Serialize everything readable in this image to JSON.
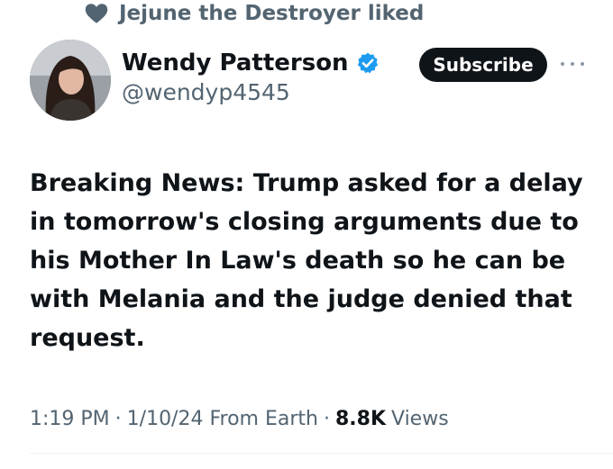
{
  "social_context": {
    "text": "Jejune the Destroyer liked",
    "icon": "heart-icon"
  },
  "author": {
    "display_name": "Wendy Patterson",
    "handle": "@wendyp4545",
    "verified": true,
    "verified_color": "#1d9bf0"
  },
  "actions": {
    "subscribe_label": "Subscribe",
    "more_icon": "more-horizontal-icon"
  },
  "tweet": {
    "text": "Breaking News: Trump asked for a delay in tomorrow's closing arguments due to his Mother In Law's death so he can be with Melania and the judge denied that request."
  },
  "meta": {
    "time": "1:19 PM",
    "date": "1/10/24",
    "source": "From Earth",
    "views_count": "8.8K",
    "views_label": "Views"
  }
}
